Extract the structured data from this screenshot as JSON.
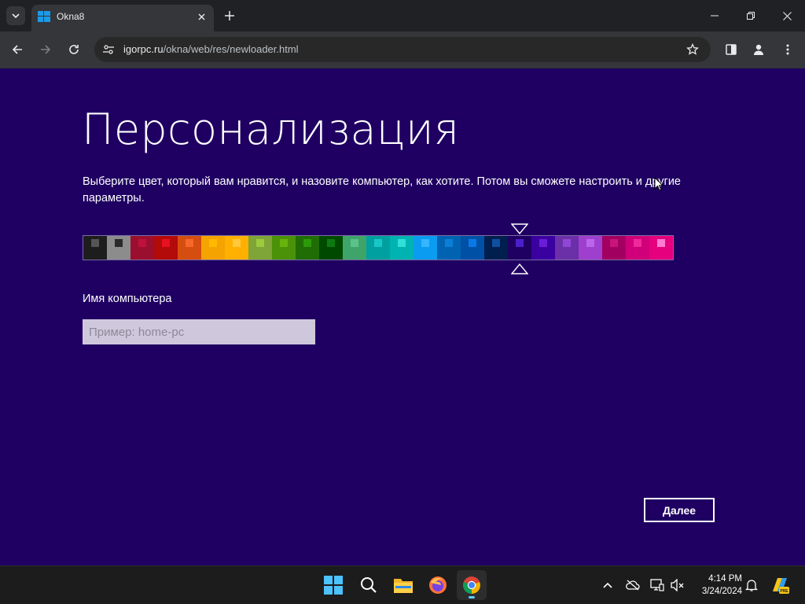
{
  "browser": {
    "tab_title": "Okna8",
    "url_host": "igorpc.ru",
    "url_path": "/okna/web/res/newloader.html"
  },
  "page": {
    "title": "Персонализация",
    "description": "Выберите цвет, который вам нравится, и назовите компьютер, как хотите. Потом вы сможете настроить и другие параметры.",
    "name_label": "Имя компьютера",
    "name_placeholder": "Пример: home-pc",
    "name_value": "",
    "next_button": "Далее",
    "selected_color_index": 18
  },
  "palette": [
    {
      "bg": "#1d1d1d",
      "fg": "#555555"
    },
    {
      "bg": "#8c8c8c",
      "fg": "#2a2a2a"
    },
    {
      "bg": "#9b0f2e",
      "fg": "#c0103c"
    },
    {
      "bg": "#b30a0a",
      "fg": "#e81123"
    },
    {
      "bg": "#d64e0f",
      "fg": "#f7672a"
    },
    {
      "bg": "#f4a300",
      "fg": "#ffb900"
    },
    {
      "bg": "#ffb000",
      "fg": "#ffc83d"
    },
    {
      "bg": "#7fa437",
      "fg": "#9ccc3c"
    },
    {
      "bg": "#4b9208",
      "fg": "#67b40e"
    },
    {
      "bg": "#1f6d04",
      "fg": "#2c9b0a"
    },
    {
      "bg": "#004a00",
      "fg": "#0d7a11"
    },
    {
      "bg": "#3ea46a",
      "fg": "#5bc389"
    },
    {
      "bg": "#00a0a0",
      "fg": "#17c6c6"
    },
    {
      "bg": "#00b3b3",
      "fg": "#2ee0d6"
    },
    {
      "bg": "#0a9cf0",
      "fg": "#35b6ff"
    },
    {
      "bg": "#0063b1",
      "fg": "#0a7fd8"
    },
    {
      "bg": "#0050a6",
      "fg": "#0a78e6"
    },
    {
      "bg": "#001e4e",
      "fg": "#0f4fa0"
    },
    {
      "bg": "#1f0062",
      "fg": "#4c1fcc"
    },
    {
      "bg": "#3b00a0",
      "fg": "#6a1ed8"
    },
    {
      "bg": "#6b2fa7",
      "fg": "#9147d6"
    },
    {
      "bg": "#9e3fce",
      "fg": "#bb66ea"
    },
    {
      "bg": "#a20060",
      "fg": "#c8157d"
    },
    {
      "bg": "#d0007a",
      "fg": "#f0299b"
    },
    {
      "bg": "#e6007e",
      "fg": "#ff7ad1"
    }
  ],
  "taskbar": {
    "time": "4:14 PM",
    "date": "3/24/2024",
    "apps": [
      "start-icon",
      "search-icon",
      "file-explorer-icon",
      "firefox-icon",
      "chrome-icon"
    ],
    "tray": [
      "chevron-up-icon",
      "cloud-icon",
      "network-icon",
      "volume-icon",
      "notification-bell-icon",
      "copilot-icon"
    ]
  }
}
